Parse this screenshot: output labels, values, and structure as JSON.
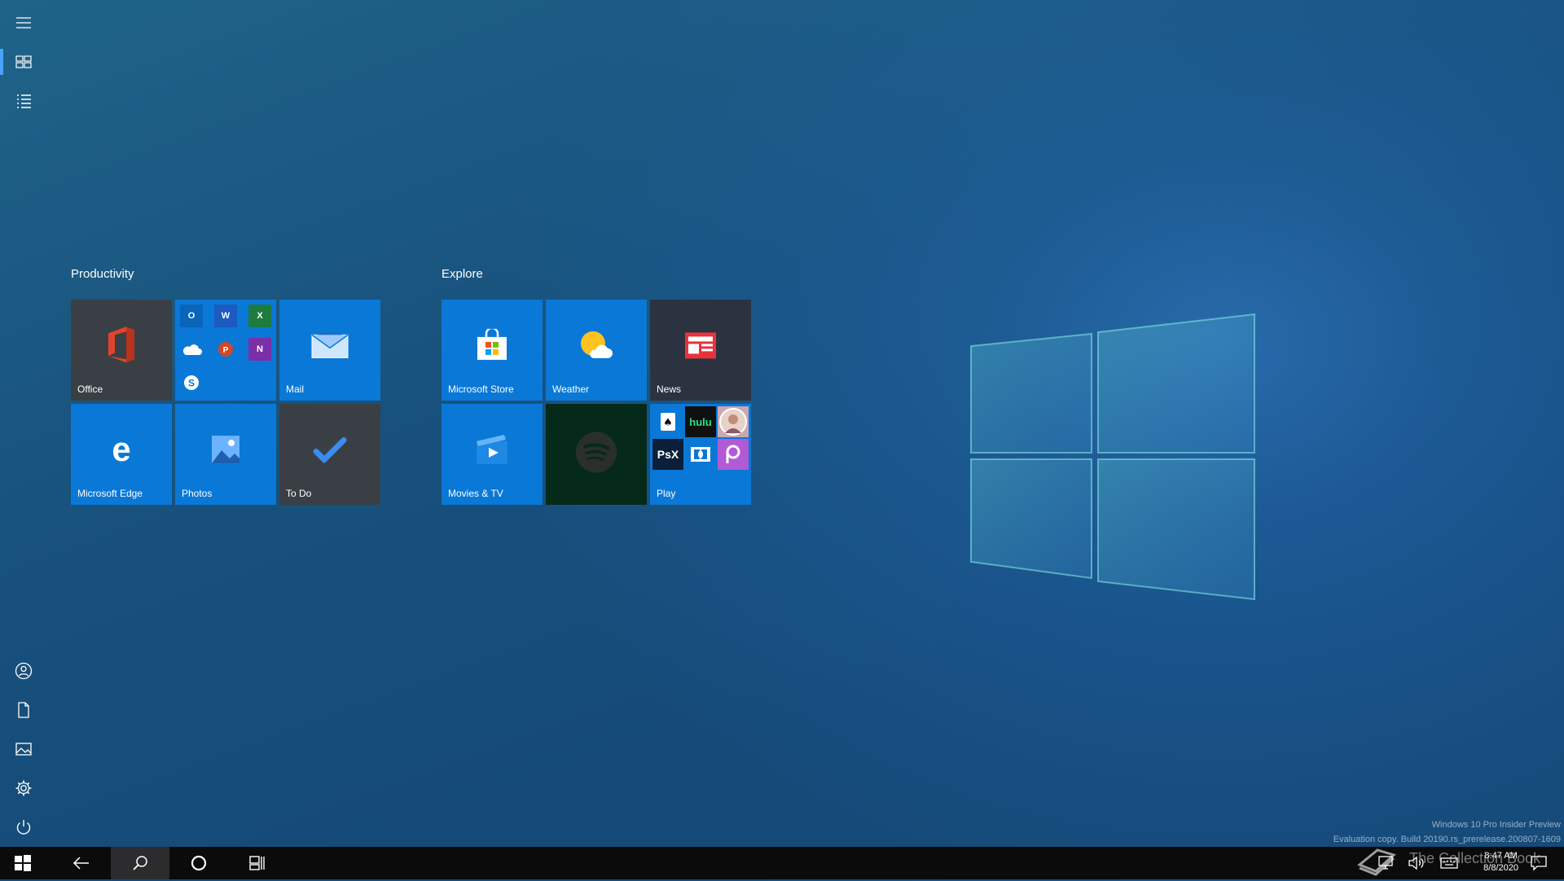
{
  "groups": [
    {
      "title": "Productivity"
    },
    {
      "title": "Explore"
    }
  ],
  "tiles": {
    "office": "Office",
    "mail": "Mail",
    "edge": "Microsoft Edge",
    "photos": "Photos",
    "todo": "To Do",
    "store": "Microsoft Store",
    "weather": "Weather",
    "news": "News",
    "movies": "Movies & TV",
    "play": "Play"
  },
  "play_folder": {
    "hulu": "hulu",
    "psx": "PsX"
  },
  "watermark": {
    "line1": "Windows 10 Pro Insider Preview",
    "line2": "Evaluation copy. Build 20190.rs_prerelease.200807-1609",
    "brand": "The Collection Book"
  },
  "clock": {
    "time": "8:47 AM",
    "date": "8/8/2020"
  },
  "colors": {
    "tile_blue": "#0a78d7",
    "accent": "#4aa3ff"
  }
}
